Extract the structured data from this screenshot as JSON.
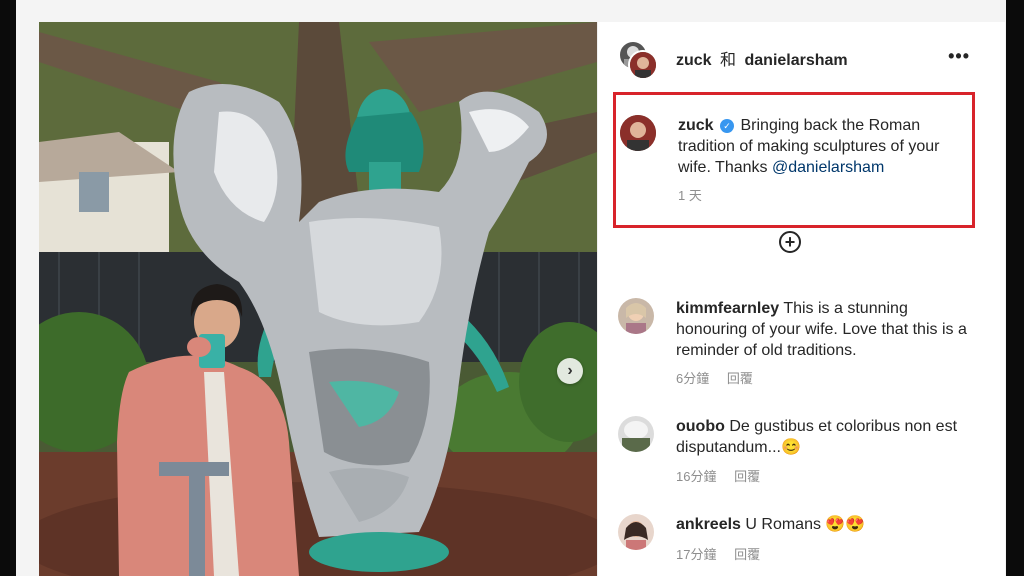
{
  "header": {
    "user1": "zuck",
    "conjunction": "和",
    "user2": "danielarsham",
    "more_icon": "more-horizontal-icon"
  },
  "caption": {
    "username": "zuck",
    "text_before": "Bringing back the Roman tradition of making sculptures of your wife. Thanks ",
    "mention": "@danielarsham",
    "time": "1 天"
  },
  "load_more_icon": "plus-circle-icon",
  "comments": [
    {
      "username": "kimmfearnley",
      "text": "This is a stunning honouring of your wife. Love that this is a reminder of old traditions.",
      "time": "6分鐘",
      "reply": "回覆"
    },
    {
      "username": "ouobo",
      "text": "De gustibus et coloribus non est disputandum...😊",
      "time": "16分鐘",
      "reply": "回覆"
    },
    {
      "username": "ankreels",
      "text": "U Romans 😍😍",
      "time": "17分鐘",
      "reply": "回覆"
    }
  ],
  "colors": {
    "highlight_border": "#d8232a",
    "verified": "#3897f0",
    "mention": "#00376b"
  }
}
